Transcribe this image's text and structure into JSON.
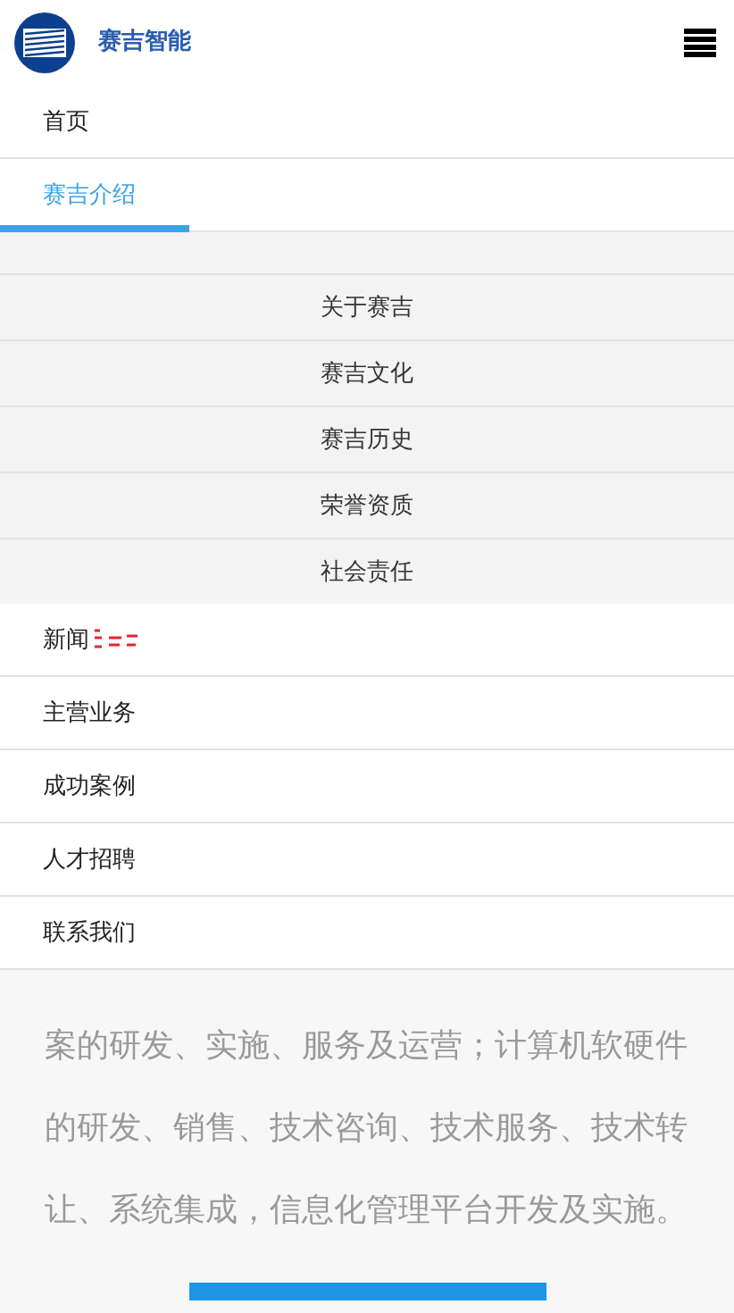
{
  "header": {
    "brand": "赛吉智能"
  },
  "menu": [
    {
      "label": "首页",
      "selected": false
    },
    {
      "label": "赛吉介绍",
      "selected": true,
      "expanded": true,
      "children": [
        {
          "label": "关于赛吉"
        },
        {
          "label": "赛吉文化"
        },
        {
          "label": "赛吉历史"
        },
        {
          "label": "荣誉资质"
        },
        {
          "label": "社会责任"
        }
      ]
    },
    {
      "label": "新闻",
      "selected": false,
      "garbled": true
    },
    {
      "label": "主营业务",
      "selected": false
    },
    {
      "label": "成功案例",
      "selected": false
    },
    {
      "label": "人才招聘",
      "selected": false
    },
    {
      "label": "联系我们",
      "selected": false
    }
  ],
  "intro": {
    "lines": [
      "案的研发、实施、服务及运营；计算机软硬件",
      "的研发、销售、技术咨询、技术服务、技术转",
      "让、系统集成，信息化管理平台开发及实施。"
    ]
  }
}
